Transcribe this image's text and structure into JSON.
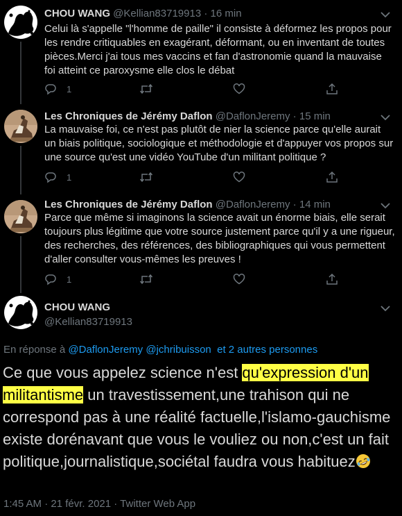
{
  "tweets": [
    {
      "name": "CHOU WANG",
      "handle": "@Kellian83719913",
      "time": "16 min",
      "text": "Celui là s'appelle  \"l'homme de paille\" il consiste à déformez les propos pour les rendre critiquables en exagérant, déformant, ou en inventant de toutes pièces.Merci j'ai tous mes vaccins et fan d'astronomie quand la mauvaise foi atteint ce paroxysme elle clos le débat",
      "reply_count": "1",
      "avatar": "bw-ink-splash"
    },
    {
      "name": "Les Chroniques de Jérémy Daflon",
      "handle": "@DaflonJeremy",
      "time": "15 min",
      "text": "La mauvaise foi, ce n'est pas plutôt de nier la science parce qu'elle aurait un biais politique, sociologique et méthodologie et d'appuyer vos propos sur une source qu'est une vidéo YouTube d'un militant politique ?",
      "reply_count": "1",
      "avatar": "painting-rider"
    },
    {
      "name": "Les Chroniques de Jérémy Daflon",
      "handle": "@DaflonJeremy",
      "time": "14 min",
      "text": "Parce que même si imaginons la science avait un énorme biais, elle serait toujours plus légitime que votre source justement parce qu'il y a une rigueur, des recherches, des références, des bibliographiques qui vous permettent d'aller consulter vous-mêmes les preuves !",
      "reply_count": "1",
      "avatar": "painting-rider"
    }
  ],
  "separator": " · ",
  "main": {
    "name": "CHOU WANG",
    "handle": "@Kellian83719913",
    "reply_prefix": "En réponse à ",
    "reply_users": "@DaflonJeremy @jchribuisson",
    "reply_others": "  et 2 autres personnes",
    "text_before": "Ce que vous appelez science n'est ",
    "text_highlight_1": "qu'expression d'un",
    "text_highlight_2": "militantisme",
    "text_after": " un travestissement,une trahison qui ne correspond pas à une réalité factuelle,l'islamo-gauchisme existe dorénavant que vous le vouliez ou non,c'est un fait politique,journalistique,sociétal faudra vous habituez",
    "emoji": "rolling-on-floor-laughing",
    "timestamp": "1:45 AM · 21 févr. 2021 · Twitter Web App"
  },
  "icons": {
    "reply": "reply-icon",
    "retweet": "retweet-icon",
    "like": "like-icon",
    "share": "share-icon",
    "more": "chevron-down-icon"
  },
  "colors": {
    "background": "#000000",
    "text": "#d9d9d9",
    "muted": "#6e767d",
    "link": "#1d9bf0",
    "highlight": "#ffff45",
    "thread_line": "#333639"
  }
}
